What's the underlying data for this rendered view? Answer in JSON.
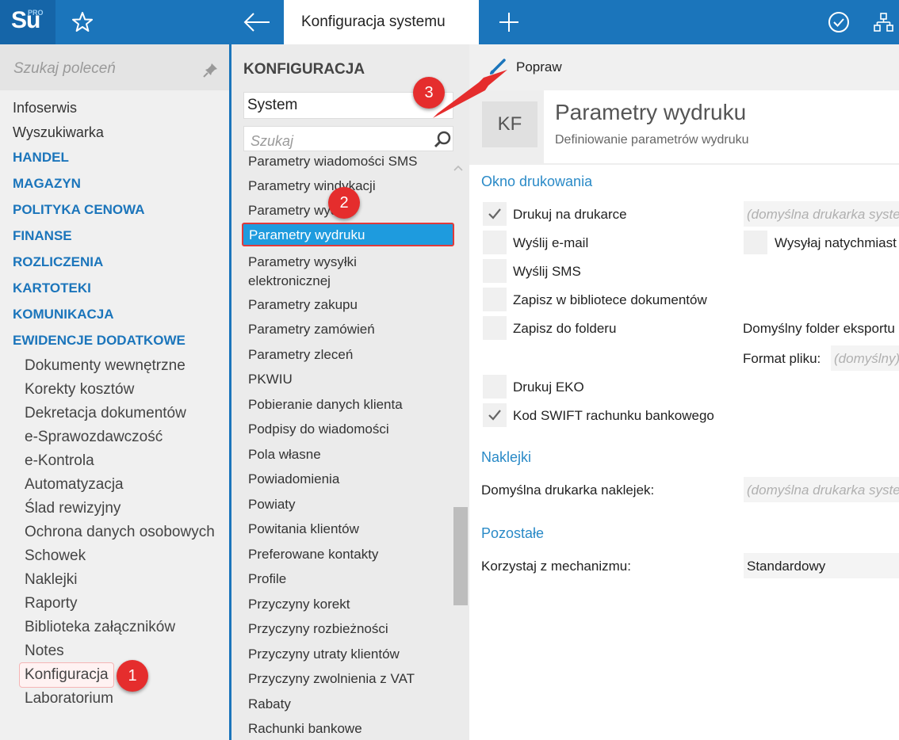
{
  "app": {
    "logo_text": "Su",
    "logo_badge": "PRO",
    "active_tab": "Konfiguracja systemu"
  },
  "sidebar": {
    "search_placeholder": "Szukaj poleceń",
    "items": [
      "Infoserwis",
      "Wyszukiwarka"
    ],
    "sections": [
      "HANDEL",
      "MAGAZYN",
      "POLITYKA CENOWA",
      "FINANSE",
      "ROZLICZENIA",
      "KARTOTEKI",
      "KOMUNIKACJA",
      "EWIDENCJE DODATKOWE"
    ],
    "subitems": [
      "Dokumenty wewnętrzne",
      "Korekty kosztów",
      "Dekretacja dokumentów",
      "e-Sprawozdawczość",
      "e-Kontrola",
      "Automatyzacja",
      "Ślad rewizyjny",
      "Ochrona danych osobowych",
      "Schowek",
      "Naklejki",
      "Raporty",
      "Biblioteka załączników",
      "Notes",
      "Konfiguracja",
      "Laboratorium"
    ]
  },
  "middle": {
    "title": "KONFIGURACJA",
    "selected_group": "System",
    "search_placeholder": "Szukaj",
    "items": [
      "Parametry wiadomości SMS",
      "Parametry windykacji",
      "Parametry wydań",
      "Parametry wydruku",
      "Parametry wysyłki elektronicznej",
      "Parametry zakupu",
      "Parametry zamówień",
      "Parametry zleceń",
      "PKWIU",
      "Pobieranie danych klienta",
      "Podpisy do wiadomości",
      "Pola własne",
      "Powiadomienia",
      "Powiaty",
      "Powitania klientów",
      "Preferowane kontakty",
      "Profile",
      "Przyczyny korekt",
      "Przyczyny rozbieżności",
      "Przyczyny utraty klientów",
      "Przyczyny zwolnienia z VAT",
      "Rabaty",
      "Rachunki bankowe"
    ],
    "selected_index": 3
  },
  "content": {
    "toolbar_label": "Popraw",
    "badge": "KF",
    "title": "Parametry wydruku",
    "subtitle": "Definiowanie parametrów wydruku",
    "section_print": "Okno drukowania",
    "options": [
      {
        "label": "Drukuj na drukarce",
        "checked": true
      },
      {
        "label": "Wyślij e-mail",
        "checked": false
      },
      {
        "label": "Wyślij SMS",
        "checked": false
      },
      {
        "label": "Zapisz w bibliotece dokumentów",
        "checked": false
      },
      {
        "label": "Zapisz do folderu",
        "checked": false
      },
      {
        "label": "Drukuj EKO",
        "checked": false
      },
      {
        "label": "Kod SWIFT rachunku bankowego",
        "checked": true
      }
    ],
    "printer_placeholder": "(domyślna drukarka systemowa)",
    "send_now_label": "Wysyłaj natychmiast",
    "send_now_checked": false,
    "export_folder_label": "Domyślny folder eksportu",
    "file_format_label": "Format pliku:",
    "file_format_placeholder": "(domyślny)",
    "section_labels": "Naklejki",
    "label_printer_label": "Domyślna drukarka naklejek:",
    "label_printer_placeholder": "(domyślna drukarka systemowa)",
    "section_other": "Pozostałe",
    "mechanism_label": "Korzystaj z mechanizmu:",
    "mechanism_value": "Standardowy"
  },
  "callouts": [
    "1",
    "2",
    "3"
  ],
  "colors": {
    "topbar": "#1b75bb",
    "accent": "#2a8ac7",
    "selected": "#1e9bde",
    "callout": "#e52d2d"
  }
}
